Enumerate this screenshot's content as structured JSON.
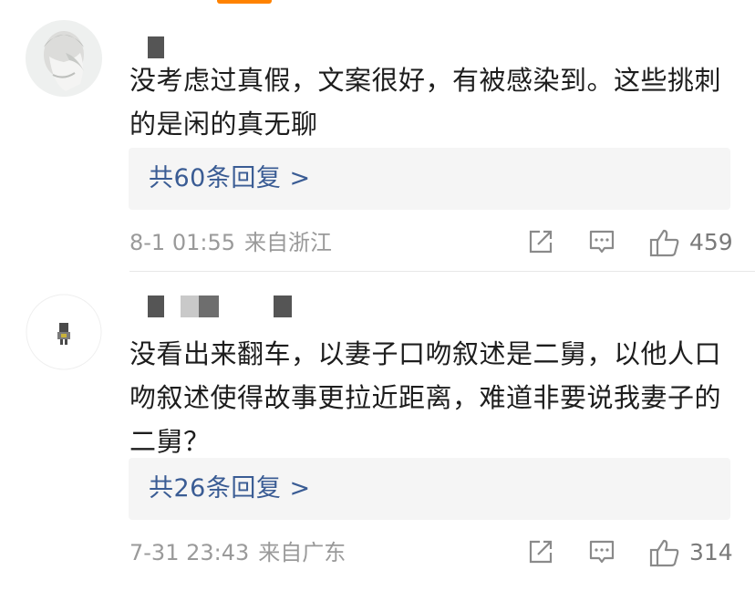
{
  "comments": [
    {
      "text": "没考虑过真假，文案很好，有被感染到。这些挑刺的是闲的真无聊",
      "replies_label": "共60条回复 >",
      "time": "8-1 01:55",
      "location": "来自浙江",
      "likes": "459"
    },
    {
      "text": "没看出来翻车，以妻子口吻叙述是二舅，以他人口吻叙述使得故事更拉近距离，难道非要说我妻子的二舅？",
      "replies_label": "共26条回复 >",
      "time": "7-31 23:43",
      "location": "来自广东",
      "likes": "314"
    }
  ],
  "icons": {
    "share": "share-icon",
    "comment": "comment-icon",
    "like": "thumbs-up-icon"
  },
  "colors": {
    "accent": "#ff8200",
    "reply_link": "#3a5c94",
    "meta": "#9a9a9a"
  }
}
